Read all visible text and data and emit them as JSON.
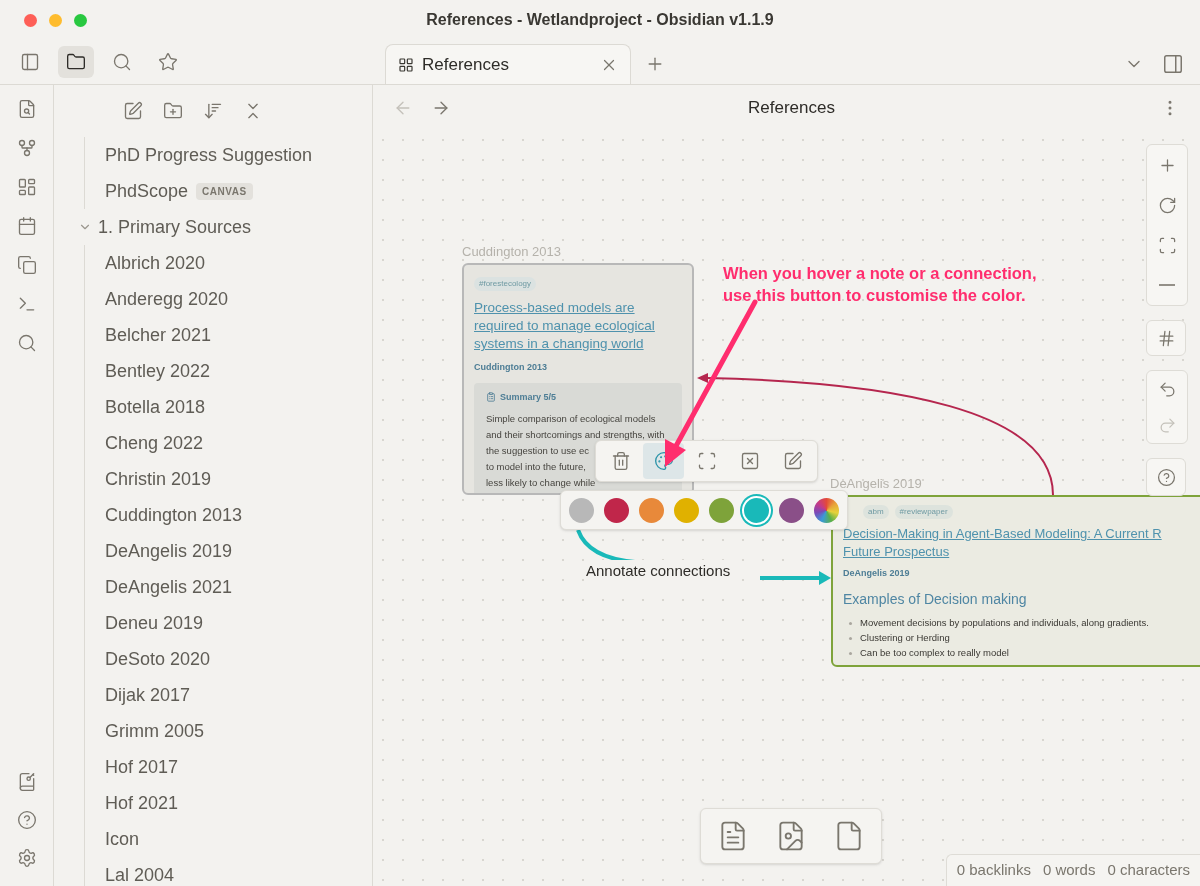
{
  "window": {
    "title": "References - Wetlandproject - Obsidian v1.1.9"
  },
  "left_toolbar": [
    {
      "selected": false
    },
    {
      "selected": true
    },
    {
      "selected": false
    },
    {
      "selected": false
    }
  ],
  "tab": {
    "label": "References"
  },
  "view_header": {
    "title": "References"
  },
  "file_tree": [
    {
      "label": "PhD Progress Suggestion",
      "kind": "file"
    },
    {
      "label": "PhdScope",
      "kind": "file",
      "badge": "CANVAS"
    },
    {
      "label": "1. Primary Sources",
      "kind": "folder",
      "expanded": true,
      "children": [
        {
          "label": "Albrich 2020",
          "kind": "file"
        },
        {
          "label": "Anderegg 2020",
          "kind": "file"
        },
        {
          "label": "Belcher 2021",
          "kind": "file"
        },
        {
          "label": "Bentley 2022",
          "kind": "file"
        },
        {
          "label": "Botella 2018",
          "kind": "file"
        },
        {
          "label": "Cheng 2022",
          "kind": "file"
        },
        {
          "label": "Christin 2019",
          "kind": "file"
        },
        {
          "label": "Cuddington 2013",
          "kind": "file"
        },
        {
          "label": "DeAngelis 2019",
          "kind": "file"
        },
        {
          "label": "DeAngelis 2021",
          "kind": "file"
        },
        {
          "label": "Deneu 2019",
          "kind": "file"
        },
        {
          "label": "DeSoto 2020",
          "kind": "file"
        },
        {
          "label": "Dijak 2017",
          "kind": "file"
        },
        {
          "label": "Grimm 2005",
          "kind": "file"
        },
        {
          "label": "Hof 2017",
          "kind": "file"
        },
        {
          "label": "Hof 2021",
          "kind": "file"
        },
        {
          "label": "Icon",
          "kind": "file"
        },
        {
          "label": "Lal 2004",
          "kind": "file"
        }
      ]
    }
  ],
  "canvas": {
    "nodes": [
      {
        "label": "Cuddington 2013",
        "color": "#b8b8b8",
        "tags": [
          "#forestecology"
        ],
        "title": [
          "Process-based models are",
          "required to manage ecological",
          "systems in a changing world"
        ],
        "subtitle": "Cuddington 2013",
        "callout": {
          "title": "Summary 5/5",
          "lines": [
            "Simple comparison of ecological models",
            "and their shortcomings and strengths, with",
            "the suggestion to use ec",
            "to model into the future,",
            "less likely to change while"
          ]
        }
      },
      {
        "label": "DeAngelis 2019",
        "color": "#7ea33a",
        "tags": [
          "abm",
          "#reviewpaper"
        ],
        "title": [
          "Decision-Making in Agent-Based Modeling: A Current R",
          "Future Prospectus"
        ],
        "subtitle": "DeAngelis 2019",
        "heading": "Examples of Decision making",
        "bullets": [
          "Movement decisions by populations and individuals, along gradients.",
          "Clustering or Herding",
          "Can be too complex to really model"
        ]
      }
    ],
    "node_toolbar": [
      {
        "selected": false
      },
      {
        "selected": true
      },
      {
        "selected": false
      },
      {
        "selected": false
      },
      {
        "selected": false
      }
    ],
    "palette": [
      {
        "kind": "preset",
        "color": "#b8b8b8",
        "selected": false
      },
      {
        "kind": "preset",
        "color": "#c0264a",
        "selected": false
      },
      {
        "kind": "preset",
        "color": "#e8893a",
        "selected": false
      },
      {
        "kind": "preset",
        "color": "#e0b100",
        "selected": false
      },
      {
        "kind": "preset",
        "color": "#7ea33a",
        "selected": false
      },
      {
        "kind": "preset",
        "color": "#19b9b9",
        "selected": true
      },
      {
        "kind": "preset",
        "color": "#8a4f88",
        "selected": false
      },
      {
        "kind": "custom",
        "selected": false
      }
    ],
    "annotation": [
      "When you hover a note or a connection,",
      "use this button to customise the color."
    ],
    "edge_label": "Annotate connections"
  },
  "status_bar": [
    "0 backlinks",
    "0 words",
    "0 characters"
  ]
}
